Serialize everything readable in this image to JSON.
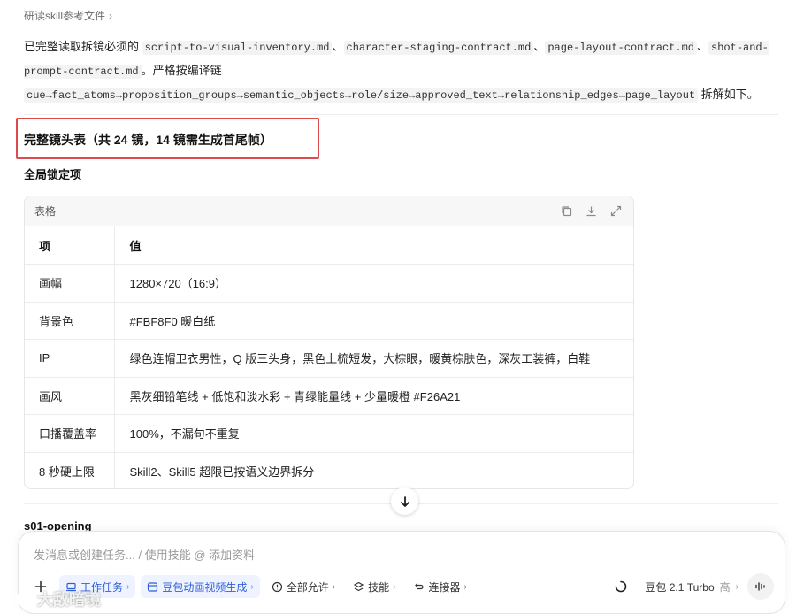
{
  "breadcrumb": {
    "label": "研读skill参考文件",
    "chevron": "›"
  },
  "intro": {
    "prefix": "已完整读取拆镜必须的",
    "files": [
      "script-to-visual-inventory.md",
      "character-staging-contract.md",
      "page-layout-contract.md",
      "shot-and-prompt-contract.md"
    ],
    "sep": "、",
    "middle": "。严格按编译链",
    "chain": "cue→fact_atoms→proposition_groups→semantic_objects→role/size→approved_text→relationship_edges→page_layout",
    "suffix": "拆解如下。"
  },
  "heading": "完整镜头表（共 24 镜，14 镜需生成首尾帧）",
  "subheading": "全局锁定项",
  "table": {
    "label": "表格",
    "icons": [
      "copy-icon",
      "download-icon",
      "expand-icon"
    ],
    "columns": [
      "项",
      "值"
    ],
    "rows": [
      [
        "画幅",
        "1280×720（16:9）"
      ],
      [
        "背景色",
        "#FBF8F0 暖白纸"
      ],
      [
        "IP",
        "绿色连帽卫衣男性，Q 版三头身，黑色上梳短发，大棕眼，暖黄棕肤色，深灰工装裤，白鞋"
      ],
      [
        "画风",
        "黑灰细铅笔线 + 低饱和淡水彩 + 青绿能量线 + 少量暖橙 #F26A21"
      ],
      [
        "口播覆盖率",
        "100%，不漏句不重复"
      ],
      [
        "8 秒硬上限",
        "Skill2、Skill5 超限已按语义边界拆分"
      ]
    ]
  },
  "next_section": "s01-opening",
  "composer": {
    "placeholder": "发消息或创建任务... / 使用技能 @ 添加资料",
    "chips": [
      {
        "label": "工作任务",
        "icon": "laptop-icon",
        "style": "blue"
      },
      {
        "label": "豆包动画视频生成",
        "icon": "app-window-icon",
        "style": "blue"
      },
      {
        "label": "全部允许",
        "icon": "info-circle-icon",
        "style": "plain"
      },
      {
        "label": "技能",
        "icon": "layers-icon",
        "style": "plain"
      },
      {
        "label": "连接器",
        "icon": "connector-icon",
        "style": "plain"
      }
    ],
    "model": "豆包 2.1 Turbo",
    "model_tier": "高"
  },
  "watermark": "大敌暗境",
  "colors": {
    "highlight_border": "#e04a4a",
    "chip_blue_bg": "#eef3ff",
    "chip_blue_text": "#2f5fd6"
  }
}
